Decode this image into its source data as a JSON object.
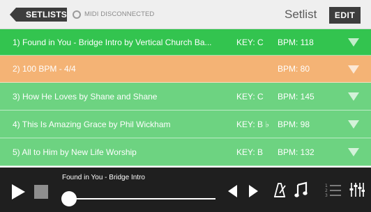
{
  "header": {
    "back_label": "SETLISTS",
    "midi_status": "MIDI DISCONNECTED",
    "title": "Setlist",
    "edit_label": "EDIT"
  },
  "songs": [
    {
      "title": "1) Found in You - Bridge Intro by Vertical Church Ba...",
      "key": "KEY: C",
      "bpm": "BPM: 118",
      "state": "selected"
    },
    {
      "title": "2) 100 BPM - 4/4",
      "key": "",
      "bpm": "BPM: 80",
      "state": "orange"
    },
    {
      "title": "3) How He Loves  by Shane and Shane",
      "key": "KEY: C",
      "bpm": "BPM: 145",
      "state": "green"
    },
    {
      "title": "4) This Is Amazing Grace  by Phil Wickham",
      "key": "KEY: B ♭",
      "bpm": "BPM: 98",
      "state": "green"
    },
    {
      "title": "5) All to Him by New Life Worship",
      "key": "KEY: B",
      "bpm": "BPM: 132",
      "state": "green"
    }
  ],
  "player": {
    "now_playing": "Found in You - Bridge Intro",
    "progress": 0.0
  },
  "colors": {
    "selected_row": "#33c44f",
    "orange_row": "#f4b375",
    "green_row": "#6dd381",
    "player_bg": "#1f1f1f",
    "header_bg": "#efefef"
  },
  "icons": [
    "play-icon",
    "stop-icon",
    "previous-icon",
    "next-icon",
    "metronome-icon",
    "music-note-icon",
    "numbered-list-icon",
    "mixer-icon"
  ]
}
